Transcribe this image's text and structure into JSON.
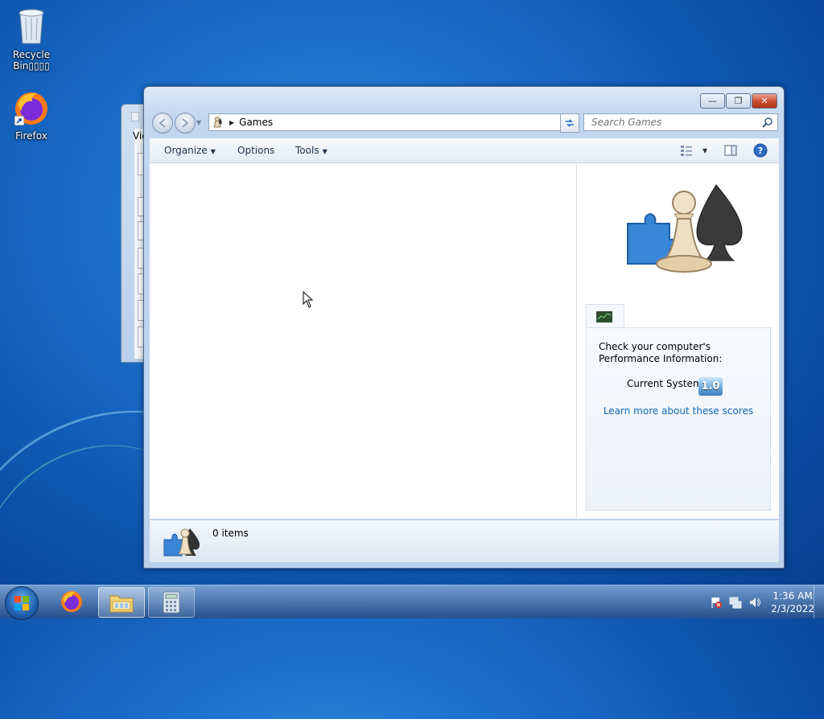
{
  "desktop": {
    "icons": [
      {
        "label": "Recycle Bin▯▯▯▯",
        "icon": "recycle-bin-icon"
      },
      {
        "label": "Firefox",
        "icon": "firefox-icon"
      }
    ],
    "background_window": {
      "label": "Vie"
    }
  },
  "window": {
    "title_buttons": {
      "minimize": "—",
      "restore": "❐",
      "close": "✕"
    },
    "address": {
      "location": "Games"
    },
    "search": {
      "placeholder": "Search Games"
    },
    "toolbar": {
      "organize": "Organize",
      "options": "Options",
      "tools": "Tools"
    },
    "panel": {
      "message": "Check your computer's Performance Information:",
      "current_system_label": "Current System",
      "score": "1.0",
      "learn_link": "Learn more about these scores"
    },
    "status": {
      "items": "0 items"
    }
  },
  "taskbar": {
    "clock_time": "1:36 AM",
    "clock_date": "2/3/2022",
    "pinned": [
      "firefox-icon",
      "explorer-icon",
      "calculator-icon"
    ]
  },
  "colors": {
    "accent": "#1a6cc8",
    "link": "#0e66b8",
    "close": "#c94a2e"
  }
}
